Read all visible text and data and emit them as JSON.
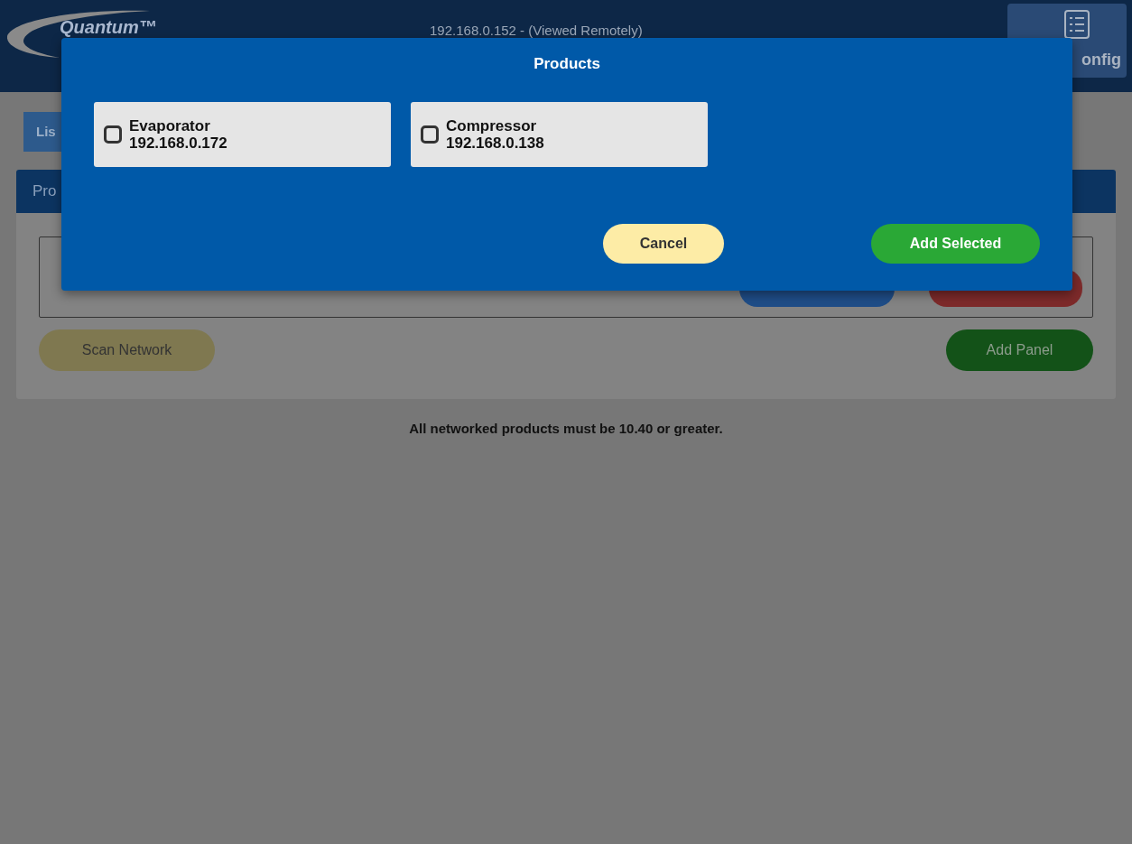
{
  "header": {
    "logo_text": "Quantum™",
    "address": "192.168.0.152 - (Viewed Remotely)",
    "config_label": "onfig"
  },
  "tabs": [
    {
      "label": "Lis",
      "selected": true
    }
  ],
  "panel": {
    "title": "Pro",
    "scan_button": "Scan Network",
    "add_button": "Add Panel"
  },
  "note": "All networked products must be 10.40 or greater.",
  "dialog": {
    "title": "Products",
    "products": [
      {
        "name": "Evaporator",
        "address": "192.168.0.172",
        "checked": false
      },
      {
        "name": "Compressor",
        "address": "192.168.0.138",
        "checked": false
      }
    ],
    "cancel": "Cancel",
    "confirm": "Add Selected"
  }
}
